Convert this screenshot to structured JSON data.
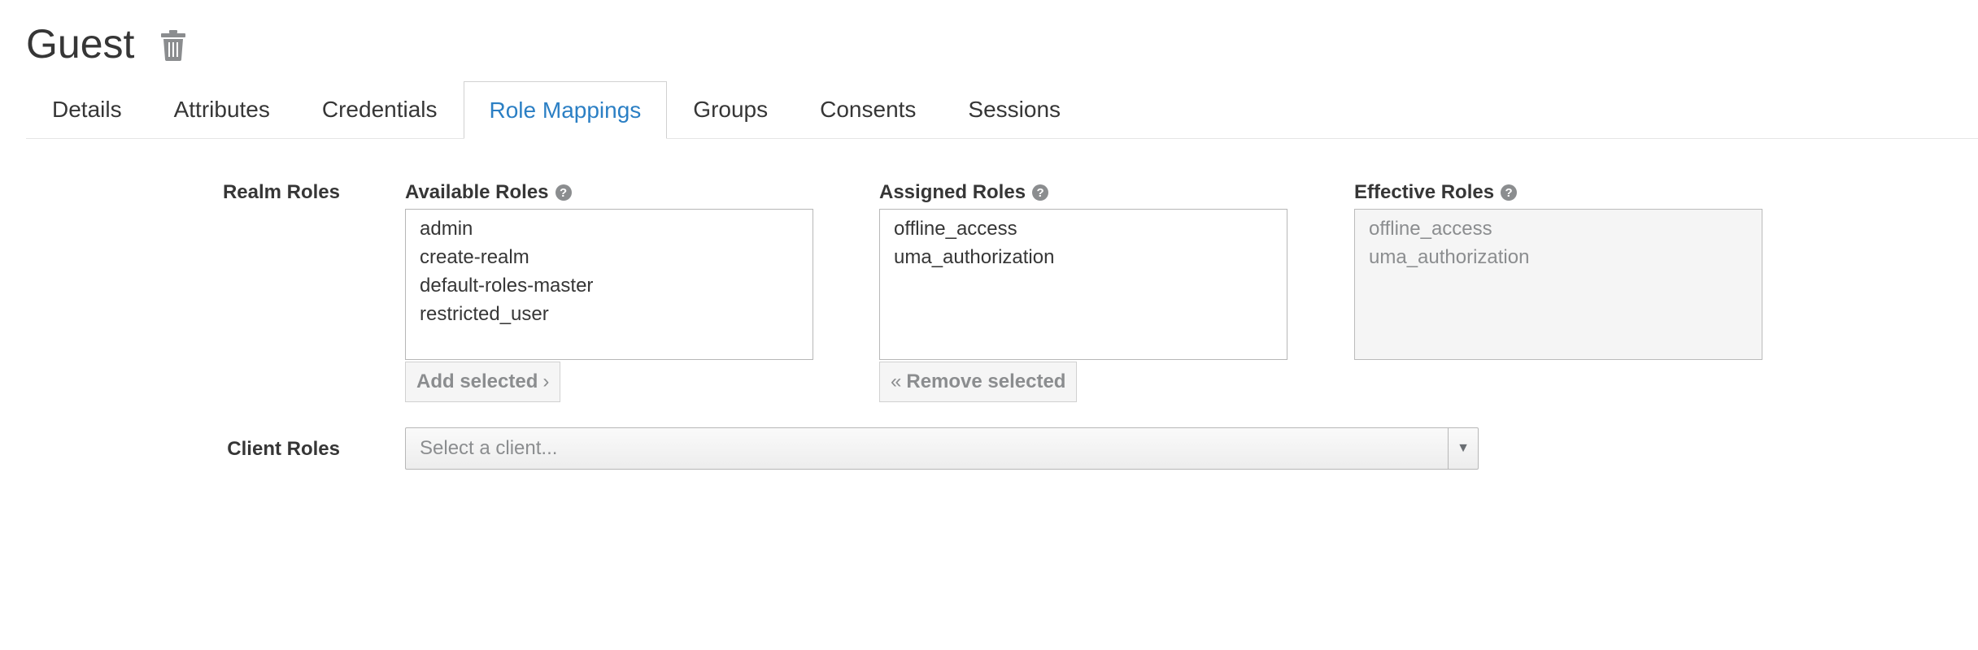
{
  "page": {
    "title": "Guest",
    "delete_icon": "trash-icon"
  },
  "tabs": [
    {
      "label": "Details",
      "active": false
    },
    {
      "label": "Attributes",
      "active": false
    },
    {
      "label": "Credentials",
      "active": false
    },
    {
      "label": "Role Mappings",
      "active": true
    },
    {
      "label": "Groups",
      "active": false
    },
    {
      "label": "Consents",
      "active": false
    },
    {
      "label": "Sessions",
      "active": false
    }
  ],
  "realm_roles": {
    "label": "Realm Roles",
    "available": {
      "label": "Available Roles",
      "help_icon": "question-circle-icon",
      "items": [
        "admin",
        "create-realm",
        "default-roles-master",
        "restricted_user"
      ],
      "button_label": "Add selected",
      "button_icon": "chevron-right-icon"
    },
    "assigned": {
      "label": "Assigned Roles",
      "help_icon": "question-circle-icon",
      "items": [
        "offline_access",
        "uma_authorization"
      ],
      "button_label": "Remove selected",
      "button_icon": "double-chevron-left-icon"
    },
    "effective": {
      "label": "Effective Roles",
      "help_icon": "question-circle-icon",
      "items": [
        "offline_access",
        "uma_authorization"
      ]
    }
  },
  "client_roles": {
    "label": "Client Roles",
    "select_placeholder": "Select a client...",
    "caret_icon": "caret-down-icon"
  },
  "colors": {
    "active_tab": "#2b7fc4",
    "text": "#363636",
    "muted": "#8b8d8f"
  }
}
